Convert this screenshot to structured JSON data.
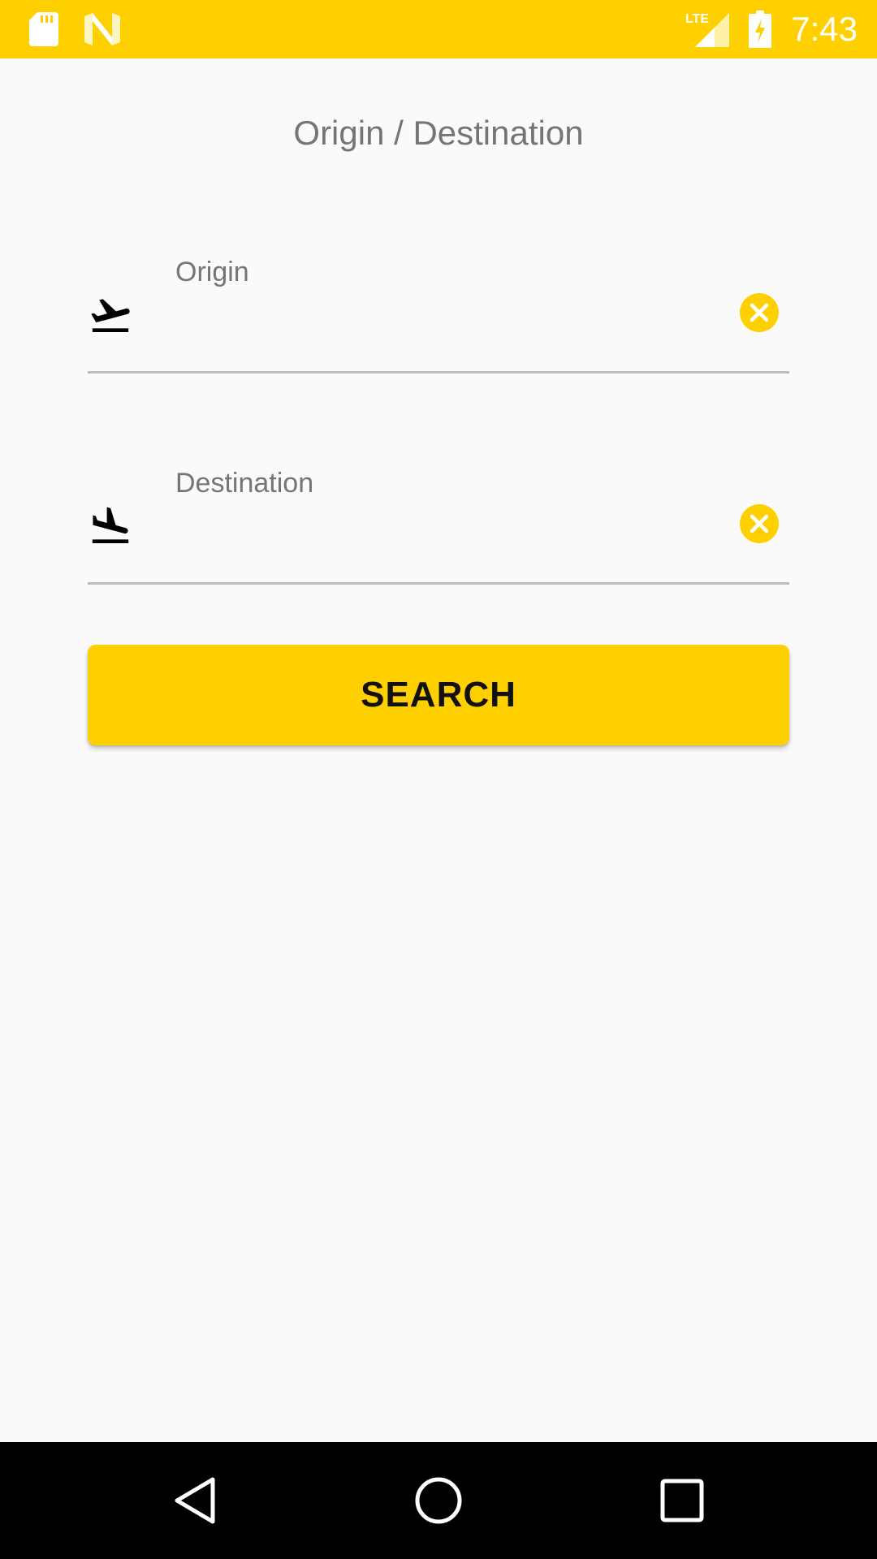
{
  "status_bar": {
    "time": "7:43",
    "icons": [
      "sd-card-icon",
      "n-logo-icon",
      "lte-signal-icon",
      "battery-charging-icon"
    ],
    "network_label": "LTE",
    "background_color": "#ffd000"
  },
  "page": {
    "title": "Origin / Destination"
  },
  "origin": {
    "label": "Origin",
    "value": "",
    "icon": "flight-takeoff-icon"
  },
  "destination": {
    "label": "Destination",
    "value": "",
    "icon": "flight-land-icon"
  },
  "search_button": {
    "label": "SEARCH"
  },
  "colors": {
    "accent": "#ffd000",
    "label_text": "#757575",
    "underline": "#bdbdbd"
  },
  "nav_bar": {
    "buttons": [
      "back-icon",
      "home-icon",
      "recents-icon"
    ]
  }
}
